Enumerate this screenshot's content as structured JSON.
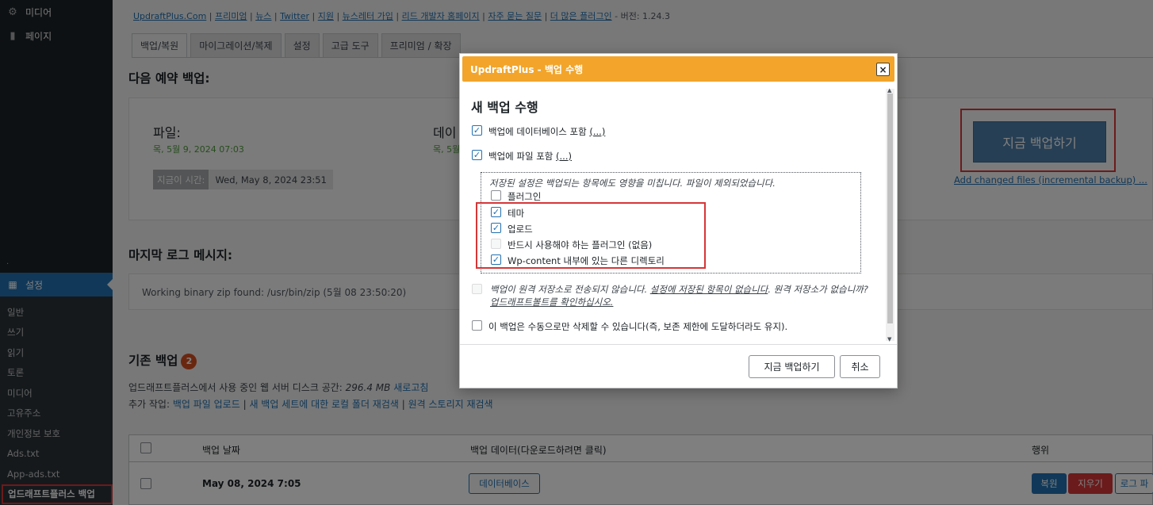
{
  "sidebar": {
    "top_items": [
      {
        "label": "미디어",
        "icon": "media-icon"
      },
      {
        "label": "페이지",
        "icon": "page-icon"
      }
    ],
    "dot": ".",
    "active_item": {
      "label": "설정",
      "icon": "settings-icon"
    },
    "submenu": [
      "일반",
      "쓰기",
      "읽기",
      "토론",
      "미디어",
      "고유주소",
      "개인정보 보호",
      "Ads.txt",
      "App-ads.txt"
    ],
    "current_sub": "업드래프트플러스 백업"
  },
  "toplinks": {
    "links": [
      "UpdraftPlus.Com",
      "프리미엄",
      "뉴스",
      "Twitter",
      "지원",
      "뉴스레터 가입",
      "리드 개발자 홈페이지",
      "자주 묻는 질문",
      "더 많은 플러그인"
    ],
    "separator": " | ",
    "version": " - 버전: 1.24.3"
  },
  "tabs": [
    "백업/복원",
    "마이그레이션/복제",
    "설정",
    "고급 도구",
    "프리미엄 / 확장"
  ],
  "next_backup": {
    "heading": "다음 예약 백업:",
    "files_label": "파일:",
    "files_time": "목, 5월 9, 2024 07:03",
    "db_label_partial": "데이",
    "db_time_partial": "목, 5월",
    "now_label": "지금이 시간:",
    "now_value": "Wed, May 8, 2024 23:51",
    "backup_now_button": "지금 백업하기",
    "incremental_link": "Add changed files (incremental backup) ..."
  },
  "last_log": {
    "heading": "마지막 로그 메시지:",
    "message": "Working binary zip found: /usr/bin/zip (5월 08 23:50:20)"
  },
  "existing": {
    "heading": "기존 백업",
    "count": "2",
    "disk_prefix": "업드래프트플러스에서 사용 중인 웹 서버 디스크 공간: ",
    "disk_value": "296.4 MB",
    "refresh": "새로고침",
    "more_prefix": "추가 작업: ",
    "more_links": [
      "백업 파일 업로드",
      "새 백업 세트에 대한 로컬 폴더 재검색",
      "원격 스토리지 재검색"
    ],
    "table": {
      "headers": [
        "백업 날짜",
        "백업 데이터(다운로드하려면 클릭)",
        "행위"
      ],
      "row_date": "May 08, 2024 7:05",
      "db_button": "데이터베이스",
      "restore": "복원",
      "delete": "지우기",
      "log": "로그 파"
    }
  },
  "dialog": {
    "title": "UpdraftPlus - 백업 수행",
    "heading": "새 백업 수행",
    "include_db": "백업에 데이터베이스 포함",
    "include_files": "백업에 파일 포함",
    "ellipsis": "(...)",
    "settings_note": "저장된 설정은 백업되는 항목에도 영향을 미칩니다. 파일이 제외되었습니다.",
    "items": [
      {
        "label": "플러그인",
        "checked": false
      },
      {
        "label": "테마",
        "checked": true
      },
      {
        "label": "업로드",
        "checked": true
      },
      {
        "label": "반드시 사용해야 하는 플러그인 (없음)",
        "checked": false
      },
      {
        "label": "Wp-content 내부에 있는 다른 디렉토리",
        "checked": true
      }
    ],
    "remote_warning_a": "백업이 원격 저장소로 전송되지 않습니다. ",
    "remote_warning_link": "설정에 저장된 항목이 없습니다",
    "remote_warning_b": ". 원격 저장소가 없습니까? ",
    "remote_warning_link2": "업드래프트볼트를 확인하십시오.",
    "manual_delete": "이 백업은 수동으로만 삭제할 수 있습니다(즉, 보존 제한에 도달하더라도 유지).",
    "backup_button": "지금 백업하기",
    "cancel_button": "취소",
    "close_symbol": "×"
  },
  "colors": {
    "sidebar_bg": "#1d2327",
    "sidebar_active": "#2271b1",
    "dialog_header": "#f2a52a",
    "link": "#2271b1",
    "highlight_red": "#d63638"
  }
}
